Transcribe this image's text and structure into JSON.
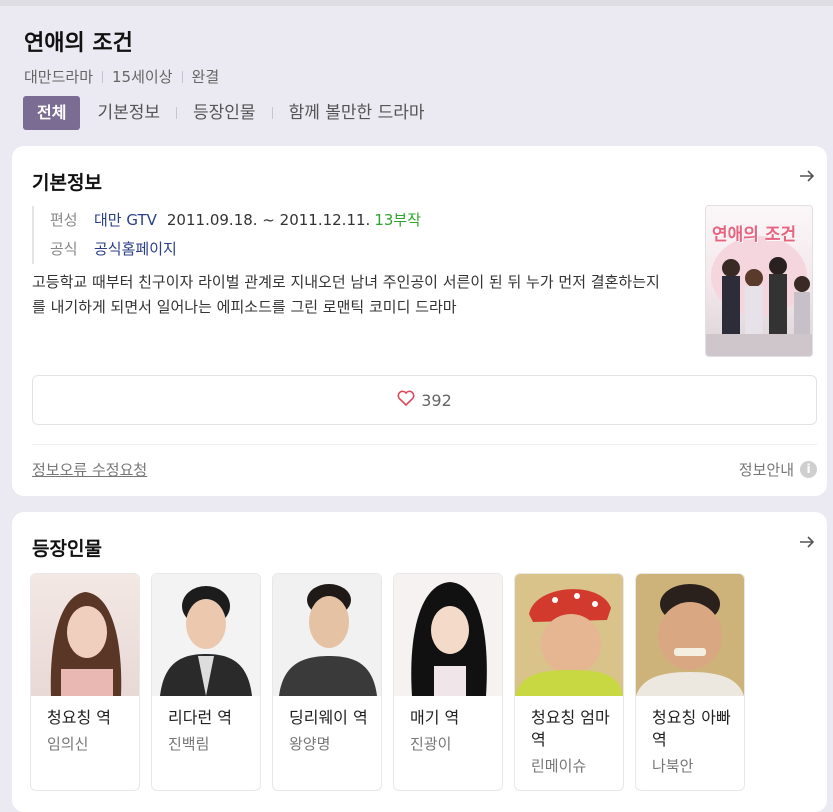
{
  "header": {
    "title": "연애의 조건",
    "meta": [
      "대만드라마",
      "15세이상",
      "완결"
    ]
  },
  "tabs": [
    "전체",
    "기본정보",
    "등장인물",
    "함께 볼만한 드라마"
  ],
  "info": {
    "section_title": "기본정보",
    "broadcast_label": "편성",
    "channel": "대만 GTV",
    "dates": "2011.09.18. ~ 2011.12.11.",
    "episodes": "13부작",
    "official_label": "공식",
    "official_link": "공식홈페이지",
    "description": "고등학교 때부터 친구이자 라이벌 관계로 지내오던 남녀 주인공이 서른이 된 뒤 누가 먼저 결혼하는지를 내기하게 되면서 일어나는 에피소드를 그린 로맨틱 코미디 드라마",
    "poster_title": "연애의 조건",
    "like_count": "392",
    "report_link": "정보오류 수정요청",
    "info_guide": "정보안내"
  },
  "cast": {
    "section_title": "등장인물",
    "members": [
      {
        "role": "청요칭 역",
        "actor": "임의신"
      },
      {
        "role": "리다런 역",
        "actor": "진백림"
      },
      {
        "role": "딩리웨이 역",
        "actor": "왕양명"
      },
      {
        "role": "매기 역",
        "actor": "진광이"
      },
      {
        "role": "청요칭 엄마 역",
        "actor": "린메이슈"
      },
      {
        "role": "청요칭 아빠 역",
        "actor": "나북안"
      }
    ]
  }
}
